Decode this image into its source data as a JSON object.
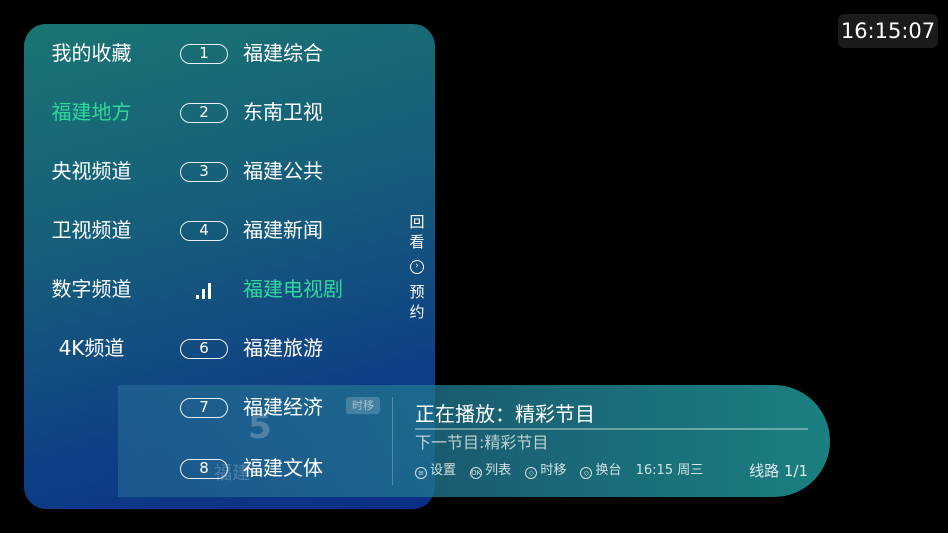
{
  "clock": "16:15:07",
  "categories": [
    {
      "label": "我的收藏",
      "active": false
    },
    {
      "label": "福建地方",
      "active": true
    },
    {
      "label": "央视频道",
      "active": false
    },
    {
      "label": "卫视频道",
      "active": false
    },
    {
      "label": "数字频道",
      "active": false
    },
    {
      "label": "4K频道",
      "active": false
    }
  ],
  "channels": [
    {
      "number": "1",
      "name": "福建综合",
      "active": false
    },
    {
      "number": "2",
      "name": "东南卫视",
      "active": false
    },
    {
      "number": "3",
      "name": "福建公共",
      "active": false
    },
    {
      "number": "4",
      "name": "福建新闻",
      "active": false
    },
    {
      "number": "",
      "name": "福建电视剧",
      "active": true,
      "playing_icon": "signal-bars-icon"
    },
    {
      "number": "6",
      "name": "福建旅游",
      "active": false
    },
    {
      "number": "7",
      "name": "福建经济",
      "active": false
    },
    {
      "number": "8",
      "name": "福建文体",
      "active": false
    }
  ],
  "side": {
    "replay": "回看",
    "reserve": "预约",
    "arrow_icon": "chevron-right-circle-icon"
  },
  "info": {
    "ghost_number": "5",
    "ghost_tag": "时移",
    "ghost_label": "福建",
    "now_playing": "正在播放：精彩节目",
    "next_program": "下一节目:精彩节目",
    "hints": [
      {
        "icon": "menu-icon",
        "glyph": "≡",
        "label": "设置"
      },
      {
        "icon": "ok-icon",
        "glyph": "OK",
        "label": "列表"
      },
      {
        "icon": "left-right-icon",
        "glyph": "◇",
        "label": "时移"
      },
      {
        "icon": "up-down-icon",
        "glyph": "◇",
        "label": "换台"
      }
    ],
    "datetime": "16:15 周三",
    "line": "线路 1/1"
  },
  "colors": {
    "accent": "#2fd89a",
    "panel_top": "#1a7572",
    "panel_bottom": "#0b2e86"
  }
}
